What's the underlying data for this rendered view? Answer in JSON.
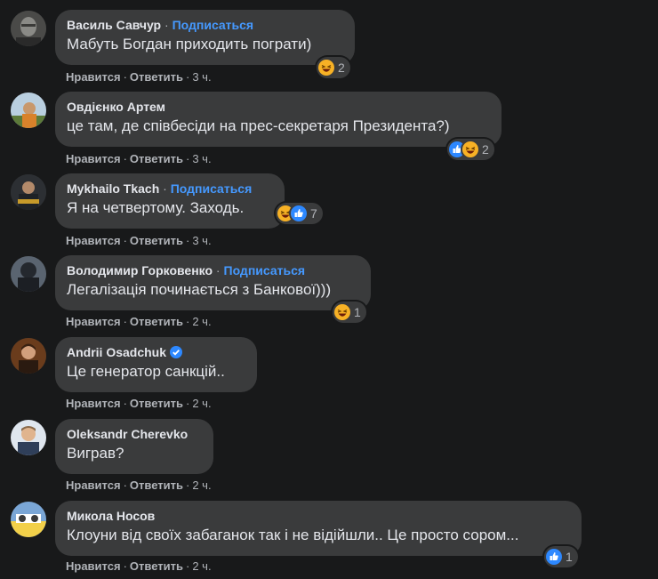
{
  "comments": [
    {
      "author": "Василь Савчур",
      "subscribe": "Подписаться",
      "verified": false,
      "text": "Мабуть Богдан приходить пограти)",
      "like": "Нравится",
      "reply": "Ответить",
      "time": "3 ч.",
      "reactions": [
        "haha-icon"
      ],
      "reaction_count": "2"
    },
    {
      "author": "Овдієнко Артем",
      "subscribe": "",
      "verified": false,
      "text": "це там, де співбесіди на прес-секретаря Президента?)",
      "like": "Нравится",
      "reply": "Ответить",
      "time": "3 ч.",
      "reactions": [
        "like-icon",
        "haha-icon"
      ],
      "reaction_count": "2"
    },
    {
      "author": "Mykhailo Tkach",
      "subscribe": "Подписаться",
      "verified": false,
      "text": "Я на четвертому. Заходь.",
      "like": "Нравится",
      "reply": "Ответить",
      "time": "3 ч.",
      "reactions": [
        "haha-icon",
        "like-icon"
      ],
      "reaction_count": "7"
    },
    {
      "author": "Володимир Горковенко",
      "subscribe": "Подписаться",
      "verified": false,
      "text": "Легалізація починається з Банкової)))",
      "like": "Нравится",
      "reply": "Ответить",
      "time": "2 ч.",
      "reactions": [
        "haha-icon"
      ],
      "reaction_count": "1"
    },
    {
      "author": "Andrii Osadchuk",
      "subscribe": "",
      "verified": true,
      "text": "Це генератор санкцій..",
      "like": "Нравится",
      "reply": "Ответить",
      "time": "2 ч.",
      "reactions": [],
      "reaction_count": ""
    },
    {
      "author": "Oleksandr Cherevko",
      "subscribe": "",
      "verified": false,
      "text": "Виграв?",
      "like": "Нравится",
      "reply": "Ответить",
      "time": "2 ч.",
      "reactions": [],
      "reaction_count": ""
    },
    {
      "author": "Микола Носов",
      "subscribe": "",
      "verified": false,
      "text": "Клоуни від своїх забаганок так і не відійшли.. Це просто сором...",
      "like": "Нравится",
      "reply": "Ответить",
      "time": "2 ч.",
      "reactions": [
        "like-icon"
      ],
      "reaction_count": "1"
    }
  ],
  "colors": {
    "background": "#18191a",
    "bubble": "#3a3b3c",
    "link": "#4599ff",
    "like": "#2d88ff",
    "haha": "#f7b125"
  }
}
